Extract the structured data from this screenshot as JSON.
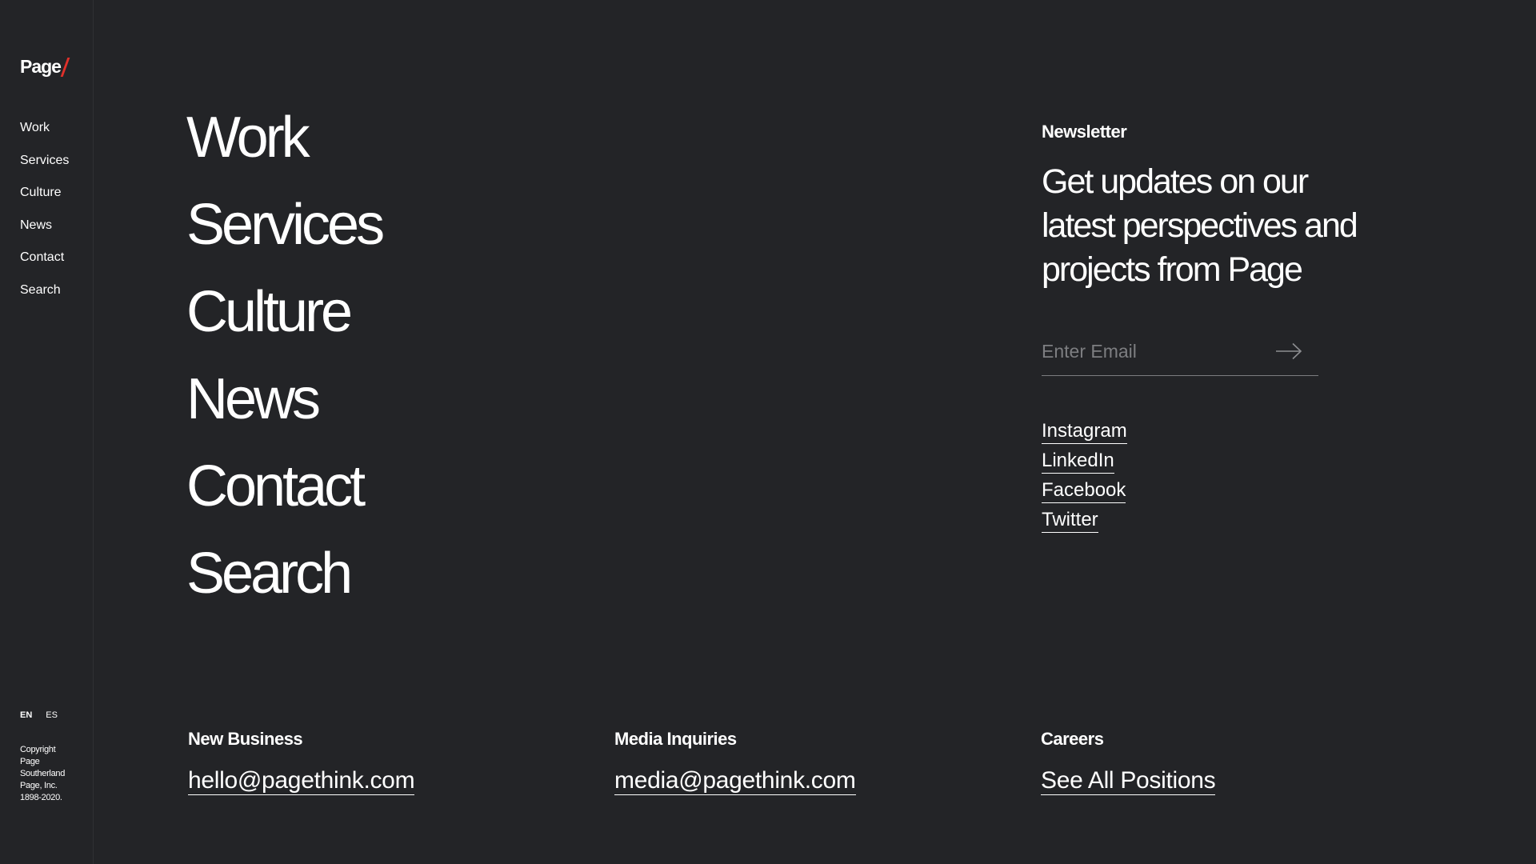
{
  "logo": {
    "text": "Page"
  },
  "sidebar": {
    "items": [
      {
        "label": "Work"
      },
      {
        "label": "Services"
      },
      {
        "label": "Culture"
      },
      {
        "label": "News"
      },
      {
        "label": "Contact"
      },
      {
        "label": "Search"
      }
    ],
    "languages": {
      "en": "EN",
      "es": "ES"
    },
    "copyright": "Copyright Page Southerland Page, Inc. 1898-2020."
  },
  "main_nav": {
    "items": [
      {
        "label": "Work"
      },
      {
        "label": "Services"
      },
      {
        "label": "Culture"
      },
      {
        "label": "News"
      },
      {
        "label": "Contact"
      },
      {
        "label": "Search"
      }
    ]
  },
  "newsletter": {
    "heading": "Newsletter",
    "text": "Get updates on our latest perspectives and projects from Page",
    "email_placeholder": "Enter Email",
    "email_value": ""
  },
  "social": {
    "items": [
      {
        "label": "Instagram"
      },
      {
        "label": "LinkedIn"
      },
      {
        "label": "Facebook"
      },
      {
        "label": "Twitter"
      }
    ]
  },
  "footer": {
    "new_business": {
      "label": "New Business",
      "link": "hello@pagethink.com"
    },
    "media": {
      "label": "Media Inquiries",
      "link": "media@pagethink.com"
    },
    "careers": {
      "label": "Careers",
      "link": "See All Positions"
    }
  },
  "colors": {
    "background": "#232427",
    "text": "#ffffff",
    "accent": "#e0302a",
    "placeholder": "#7d7e81"
  }
}
